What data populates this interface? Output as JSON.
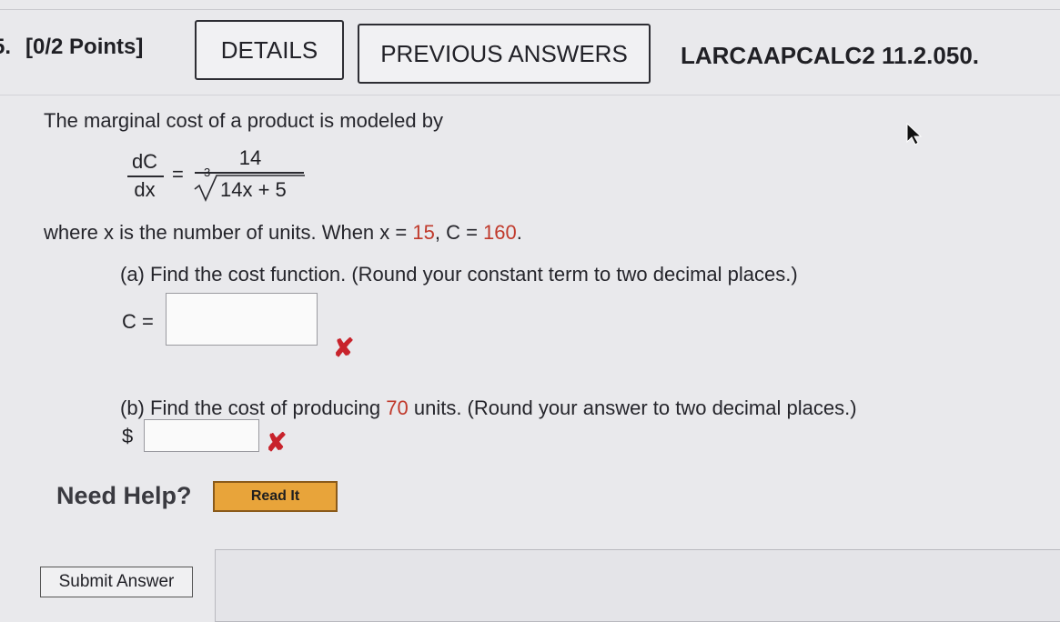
{
  "header": {
    "question_number": "5.",
    "points": "[0/2 Points]",
    "details_label": "DETAILS",
    "previous_answers_label": "PREVIOUS ANSWERS",
    "problem_code": "LARCAAPCALC2 11.2.050."
  },
  "problem": {
    "intro": "The marginal cost of a product is modeled by",
    "derivative_num": "dC",
    "derivative_den": "dx",
    "equals": "=",
    "numerator": "14",
    "root_index": "3",
    "radicand": "14x + 5",
    "condition_prefix": "where x is the number of units. When x = ",
    "x_value": "15",
    "condition_mid": ", C = ",
    "c_value": "160",
    "condition_suffix": "."
  },
  "part_a": {
    "prompt": "(a) Find the cost function. (Round your constant term to two decimal places.)",
    "label": "C =",
    "value": "",
    "status": "incorrect"
  },
  "part_b": {
    "prompt_prefix": "(b) Find the cost of producing ",
    "units": "70",
    "prompt_suffix": " units. (Round your answer to two decimal places.)",
    "currency": "$",
    "value": "",
    "status": "incorrect"
  },
  "help": {
    "label": "Need Help?",
    "read_it_label": "Read It"
  },
  "submit_label": "Submit Answer",
  "colors": {
    "incorrect_mark": "#c8232c",
    "given_value": "#c0392b",
    "read_it_button": "#e8a43a"
  },
  "icons": {
    "wrong": "close-icon",
    "pointer": "cursor-icon"
  }
}
